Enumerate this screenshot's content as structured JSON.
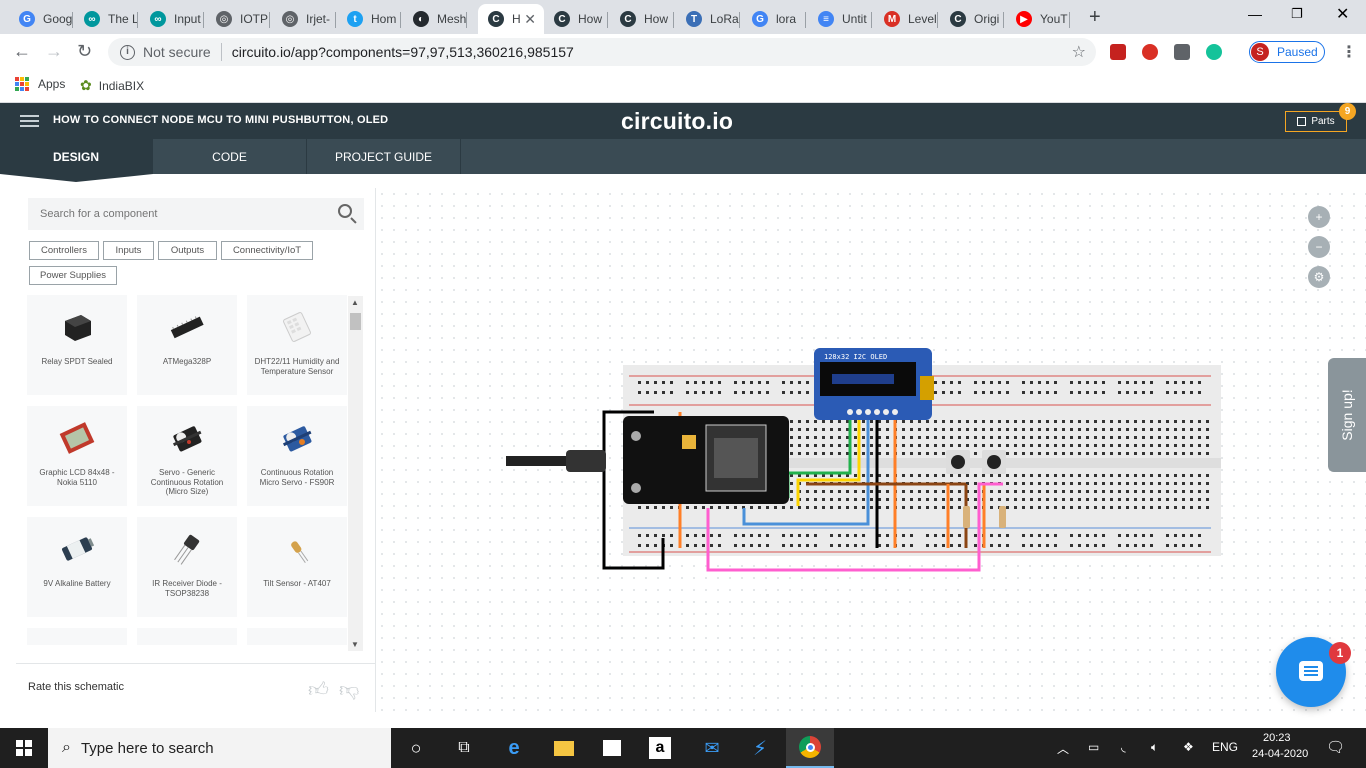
{
  "browser": {
    "tabs": [
      {
        "title": "Goog",
        "icon": "google-icon",
        "color": "#4285f4",
        "glyph": "G"
      },
      {
        "title": "The L",
        "icon": "arduino-icon",
        "color": "#00979d",
        "glyph": "∞"
      },
      {
        "title": "Input",
        "icon": "arduino-icon",
        "color": "#00979d",
        "glyph": "∞"
      },
      {
        "title": "IOTP",
        "icon": "globe-icon",
        "color": "#5f6368",
        "glyph": "◎"
      },
      {
        "title": "Irjet-",
        "icon": "globe-icon",
        "color": "#5f6368",
        "glyph": "◎"
      },
      {
        "title": "Hom",
        "icon": "site-icon",
        "color": "#1da1f2",
        "glyph": "t"
      },
      {
        "title": "Mesh",
        "icon": "github-icon",
        "color": "#24292e",
        "glyph": "◐"
      },
      {
        "title": "H",
        "icon": "circuito-icon",
        "color": "#2b3a42",
        "glyph": "C"
      },
      {
        "title": "How",
        "icon": "circuito-icon",
        "color": "#2b3a42",
        "glyph": "C"
      },
      {
        "title": "How",
        "icon": "circuito-icon",
        "color": "#2b3a42",
        "glyph": "C"
      },
      {
        "title": "LoRa",
        "icon": "techo-icon",
        "color": "#3b6fb6",
        "glyph": "T"
      },
      {
        "title": "lora",
        "icon": "google-icon",
        "color": "#4285f4",
        "glyph": "G"
      },
      {
        "title": "Untit",
        "icon": "docs-icon",
        "color": "#4285f4",
        "glyph": "≡"
      },
      {
        "title": "Level",
        "icon": "gmail-icon",
        "color": "#d93025",
        "glyph": "M"
      },
      {
        "title": "Origi",
        "icon": "circuito-icon",
        "color": "#2b3a42",
        "glyph": "C"
      },
      {
        "title": "YouT",
        "icon": "youtube-icon",
        "color": "#ff0000",
        "glyph": "▶"
      }
    ],
    "active_tab_index": 7,
    "url_warning": "Not secure",
    "url": "circuito.io/app?components=97,97,513,360216,985157",
    "profile_initial": "S",
    "profile_label": "Paused",
    "bookmarks": [
      {
        "label": "Apps",
        "icon": "apps-grid-icon"
      },
      {
        "label": "IndiaBIX",
        "icon": "indiabix-icon"
      }
    ]
  },
  "app": {
    "project_title": "HOW TO CONNECT NODE MCU TO MINI PUSHBUTTON, OLED",
    "brand": "circuito.io",
    "parts_label": "Parts",
    "parts_count": "9",
    "tabs": [
      "DESIGN",
      "CODE",
      "PROJECT GUIDE"
    ],
    "active_tab": "DESIGN",
    "search_placeholder": "Search for a component",
    "filters": [
      "Controllers",
      "Inputs",
      "Outputs",
      "Connectivity/IoT",
      "Power Supplies"
    ],
    "components": [
      {
        "label": "Relay SPDT Sealed",
        "icon": "relay-icon"
      },
      {
        "label": "ATMega328P",
        "icon": "chip-icon"
      },
      {
        "label": "DHT22/11 Humidity and Temperature Sensor",
        "icon": "dht-sensor-icon"
      },
      {
        "label": "Graphic LCD 84x48 - Nokia 5110",
        "icon": "lcd-icon"
      },
      {
        "label": "Servo - Generic Continuous Rotation (Micro Size)",
        "icon": "servo-icon"
      },
      {
        "label": "Continuous Rotation Micro Servo - FS90R",
        "icon": "servo-blue-icon"
      },
      {
        "label": "9V Alkaline Battery",
        "icon": "battery-icon"
      },
      {
        "label": "IR Receiver Diode - TSOP38238",
        "icon": "ir-receiver-icon"
      },
      {
        "label": "Tilt Sensor - AT407",
        "icon": "tilt-sensor-icon"
      }
    ],
    "rate_label": "Rate this schematic",
    "signup_label": "Sign up!",
    "chat_badge": "1",
    "oled_label": "128x32 I2C OLED"
  },
  "taskbar": {
    "search_placeholder": "Type here to search",
    "language": "ENG",
    "time": "20:23",
    "date": "24-04-2020"
  },
  "colors": {
    "header_bg": "#2b3a42",
    "tabs_bg": "#3a4b54",
    "accent_orange": "#f5a623",
    "chat_blue": "#1f8ceb"
  }
}
